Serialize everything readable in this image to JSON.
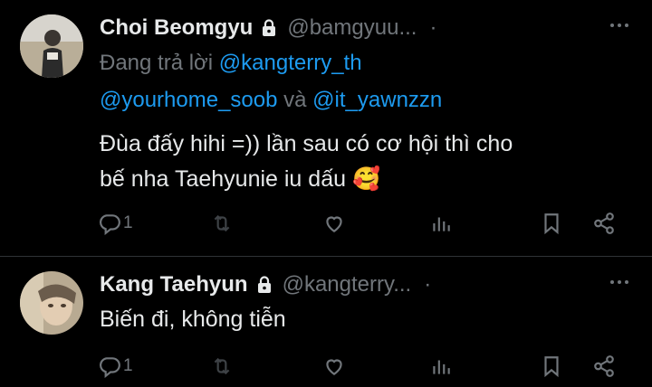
{
  "tweets": [
    {
      "name": "Choi Beomgyu",
      "handle": "@bamgyuu...",
      "separator": "·",
      "reply_prefix": "Đang trả lời ",
      "mention1": "@kangterry_th",
      "mention2": "@yourhome_soob",
      "conj": " và ",
      "mention3": "@it_yawnzzn",
      "text_line1": "Đùa đấy hihi =)) lần sau có cơ hội thì cho",
      "text_line2": "bế nha Taehyunie iu dấu",
      "emoji": "🥰",
      "reply_count": "1"
    },
    {
      "name": "Kang Taehyun",
      "handle": "@kangterry...",
      "separator": "·",
      "text_line1": "Biến đi, không tiễn",
      "reply_count": "1"
    }
  ],
  "icons": [
    "lock-icon",
    "more-icon",
    "reply-icon",
    "retweet-icon",
    "like-icon",
    "views-icon",
    "bookmark-icon",
    "share-icon"
  ],
  "colors": {
    "background": "#000000",
    "text": "#e7e9ea",
    "muted": "#71767b",
    "link": "#1d9bf0"
  }
}
